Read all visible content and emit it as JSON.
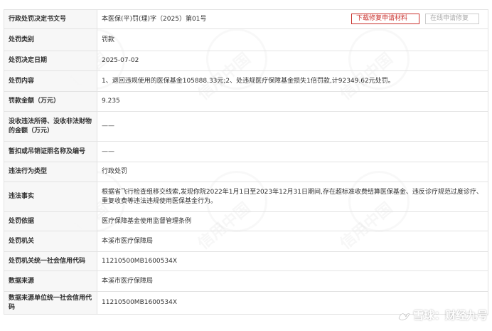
{
  "table": {
    "rows": [
      {
        "label": "行政处罚决定书文号",
        "value": "本医保(平)罚(理)字（2025）第01号"
      },
      {
        "label": "处罚类别",
        "value": "罚款"
      },
      {
        "label": "处罚决定日期",
        "value": "2025-07-02"
      },
      {
        "label": "处罚内容",
        "value": "1、退回违规使用的医保基金105888.33元;2、处违规医疗保障基金损失1倍罚款,计92349.62元处罚。"
      },
      {
        "label": "罚款金额（万元）",
        "value": "9.235"
      },
      {
        "label": "没收违法所得、没收非法财物的金额（万元）",
        "value": "——"
      },
      {
        "label": "暂扣或吊销证照名称及编号",
        "value": "——"
      },
      {
        "label": "违法行为类型",
        "value": "行政处罚"
      },
      {
        "label": "违法事实",
        "value": "根据省飞行检查组移交线索,发现你院2022年1月1日至2023年12月31日期间,存在超标准收费结算医保基金、违反诊疗规范过度诊疗、重复收费等违法违规使用医保基金行为。"
      },
      {
        "label": "处罚依据",
        "value": "医疗保障基金使用监督管理条例"
      },
      {
        "label": "处罚机关",
        "value": "本溪市医疗保障局"
      },
      {
        "label": "处罚机关统一社会信用代码",
        "value": "11210500MB1600534X"
      },
      {
        "label": "数据来源",
        "value": "本溪市医疗保障局"
      },
      {
        "label": "数据来源单位统一社会信用代码",
        "value": "11210500MB1600534X"
      }
    ]
  },
  "actions": {
    "download_label": "下载修复申请材料",
    "online_label": "在线申请修复"
  },
  "watermark": {
    "text": "信用中国"
  },
  "brand": {
    "text": "雪球：财经九号"
  },
  "colors": {
    "accent": "#c9302c",
    "label_bg": "#f6f6f6",
    "border": "#e3e3e3"
  }
}
